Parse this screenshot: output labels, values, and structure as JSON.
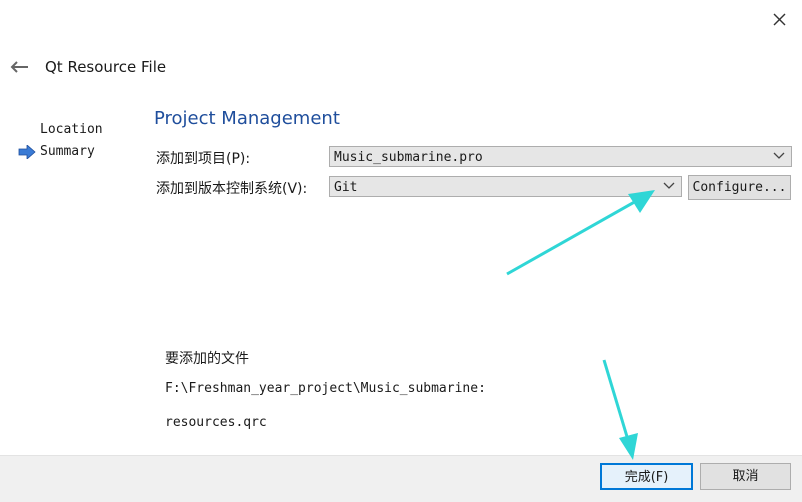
{
  "window": {
    "close_icon": "close-icon",
    "back_icon": "back-arrow-icon",
    "title": "Qt Resource File"
  },
  "sidebar": {
    "steps": [
      {
        "label": "Location",
        "current": false
      },
      {
        "label": "Summary",
        "current": true
      }
    ],
    "current_icon": "right-arrow-icon"
  },
  "page": {
    "heading": "Project Management"
  },
  "form": {
    "project_label": "添加到项目(P):",
    "project_value": "Music_submarine.pro",
    "vcs_label": "添加到版本控制系统(V):",
    "vcs_value": "Git",
    "configure_label": "Configure..."
  },
  "files": {
    "heading": "要添加的文件",
    "path": "F:\\Freshman_year_project\\Music_submarine:",
    "items": [
      "resources.qrc"
    ]
  },
  "footer": {
    "finish_label": "完成(F)",
    "cancel_label": "取消"
  },
  "colors": {
    "heading": "#1f4e9c",
    "annotation_arrow": "#2fd6d6",
    "default_button_border": "#0078d7",
    "step_arrow": "#3a7bd5"
  }
}
